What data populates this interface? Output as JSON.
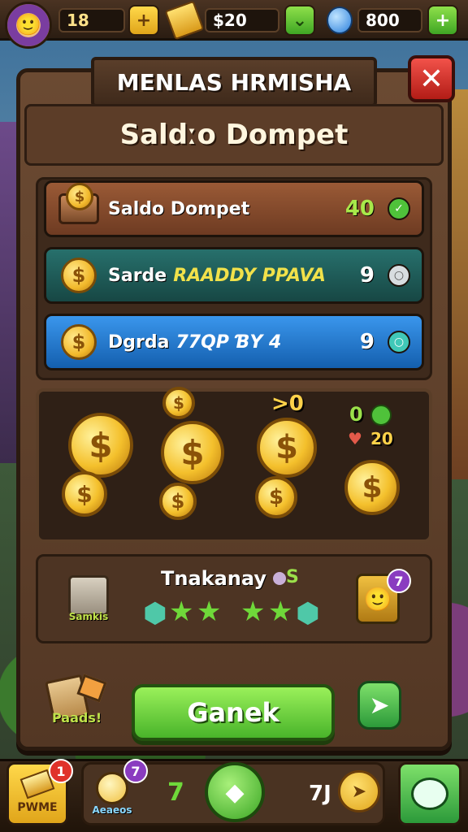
{
  "topbar": {
    "level": "18",
    "money": "$20",
    "gems": "800"
  },
  "panel": {
    "title": "MENLAS HRMISHA",
    "close": "✕",
    "subtitle": "Saldːo Dompet"
  },
  "rows": [
    {
      "label": "Saldo Dompet",
      "extra": "",
      "value": "40",
      "badge": "✓",
      "color": "#8a4a2c"
    },
    {
      "label": "Sarde",
      "extra": "RAADDY PPAVA",
      "value": "9",
      "badge": "○",
      "color": "#1f5b5a"
    },
    {
      "label": "Dgrda",
      "extra": "77QP ƁY 4",
      "value": "9",
      "badge": "○",
      "color": "#1f73c8"
    }
  ],
  "coinbox": {
    "label_a": ">0",
    "label_b": "0",
    "label_c": "20"
  },
  "achievement": {
    "title": "Tnakanay",
    "suffix": "S",
    "shop_label": "Samkis",
    "portrait_badge": "7"
  },
  "actions": {
    "paper_label": "Paads!",
    "main_button": "Ganek"
  },
  "bottom_nav": {
    "left_label": "PWME",
    "left_badge": "1",
    "second_label": "Aeaeos",
    "second_badge": "7",
    "center_num": "7",
    "right_num": "7J"
  }
}
